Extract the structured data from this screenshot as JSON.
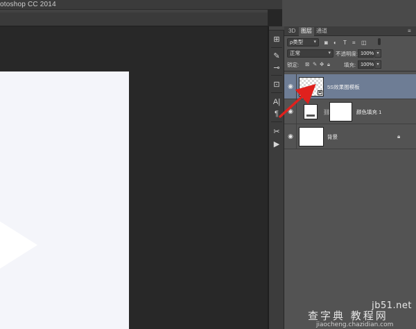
{
  "app": {
    "title": "otoshop CC 2014"
  },
  "dock": {
    "tools": [
      {
        "icon": "brush-preset-icon",
        "glyph": "⊞"
      },
      {
        "icon": "brush-tool-icon",
        "glyph": "✎"
      },
      {
        "icon": "adjust-icon",
        "glyph": "⊸"
      },
      {
        "icon": "clone-source-icon",
        "glyph": "⊡"
      },
      {
        "icon": "character-icon",
        "glyph": "A|"
      },
      {
        "icon": "paragraph-icon",
        "glyph": "¶"
      },
      {
        "icon": "tools-icon",
        "glyph": "✂"
      },
      {
        "icon": "play-icon",
        "glyph": "▶"
      }
    ]
  },
  "panel": {
    "tabs": [
      "3D",
      "图层",
      "通道"
    ],
    "active_tab": "图层",
    "menu_glyph": "≡",
    "filter": {
      "label": "ρ类型",
      "filter_icons": [
        "◙",
        "◐",
        "T",
        "⌗",
        "◫"
      ]
    },
    "blend": {
      "mode": "正常",
      "opacity_label": "不透明度:",
      "opacity_value": "100%"
    },
    "lock": {
      "label": "锁定:",
      "fill_label": "填充:",
      "fill_value": "100%"
    },
    "layers": [
      {
        "name": "5S效果图模板",
        "selected": true,
        "type": "smart-object"
      },
      {
        "name": "颜色填充 1",
        "selected": false,
        "type": "fill"
      },
      {
        "name": "背景",
        "selected": false,
        "type": "background",
        "locked": true
      }
    ]
  },
  "watermark": {
    "site": "jb51.net",
    "brand": "查字典 教程网",
    "url": "jiaocheng.chazidian.com"
  },
  "colors": {
    "selected_layer": "#6e7d95",
    "arrow": "#e0211d",
    "canvas_doc": "#f4f5fa"
  }
}
